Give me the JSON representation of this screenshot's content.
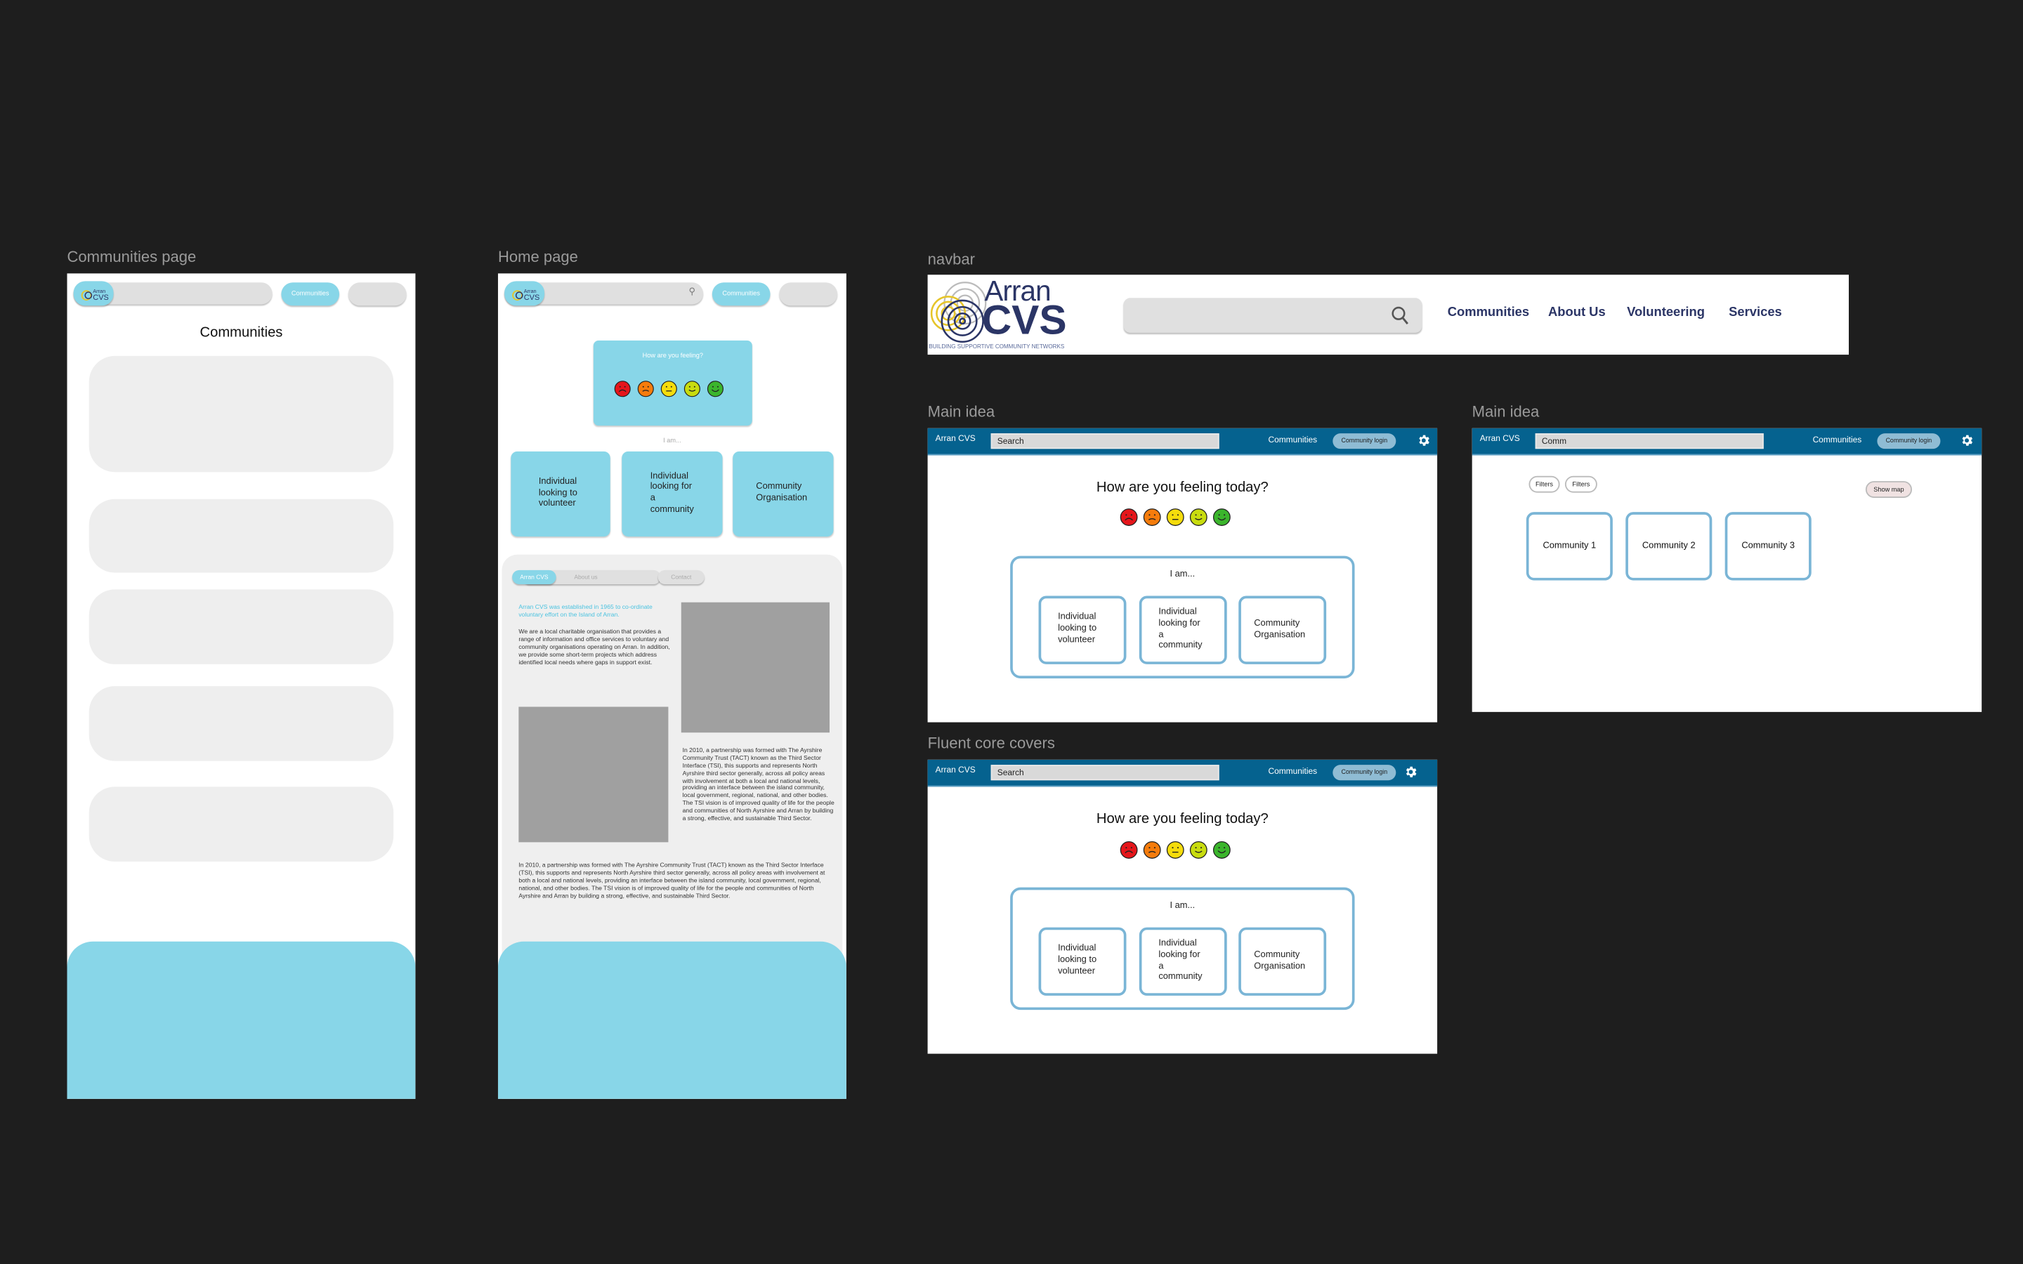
{
  "labels": {
    "communities_page": "Communities page",
    "home_page": "Home page",
    "navbar": "navbar",
    "main_idea_1": "Main idea",
    "main_idea_2": "Main idea",
    "fluent": "Fluent core covers"
  },
  "logo": {
    "line1": "Arran",
    "line2": "CVS",
    "tagline": "BUILDING SUPPORTIVE COMMUNITY NETWORKS"
  },
  "mobile": {
    "communities_btn": "Communities",
    "communities_title": "Communities"
  },
  "home": {
    "feeling": "How are you feeling?",
    "i_am": "I am...",
    "options": [
      "Individual looking to volunteer",
      "Individual looking for a community",
      "Community Organisation"
    ],
    "tabs": [
      "Arran CVS",
      "About us",
      "Contact"
    ],
    "intro": "Arran CVS was established in 1965 to co-ordinate voluntary effort on the Island of Arran.",
    "para1": "We are a local charitable organisation that provides a range of information and office services to voluntary and community organisations operating on Arran. In addition, we provide some short-term projects which address identified local needs where gaps in support exist.",
    "para2": "In 2010, a partnership was formed with The Ayrshire Community Trust (TACT) known as the Third Sector Interface (TSI), this supports and represents North Ayrshire third sector generally, across all policy areas with involvement at both a local and national levels, providing an interface between the island community, local government, regional, national, and other bodies. The TSI vision is of improved quality of life for the people and communities of North Ayrshire and Arran by building a strong, effective, and sustainable Third Sector.",
    "para3": "In 2010, a partnership was formed with The Ayrshire Community Trust (TACT) known as the Third Sector Interface (TSI), this supports and represents North Ayrshire third sector generally, across all policy areas with involvement at both a local and national levels, providing an interface between the island community, local government, regional, national, and other bodies. The TSI vision is of improved quality of life for the people and communities of North Ayrshire and Arran by building a strong, effective, and sustainable Third Sector."
  },
  "navbar": {
    "links": [
      "Communities",
      "About Us",
      "Volunteering",
      "Services"
    ]
  },
  "desktop": {
    "brand": "Arran CVS",
    "search_value": "Search",
    "communities": "Communities",
    "login": "Community login",
    "feeling": "How are you feeling today?",
    "i_am": "I am...",
    "options": [
      "Individual looking to volunteer",
      "Individual looking for a community",
      "Community Organisation"
    ]
  },
  "desktop2": {
    "search_value": "Comm",
    "filters": [
      "Filters",
      "Filters"
    ],
    "show_map": "Show map",
    "cards": [
      "Community 1",
      "Community 2",
      "Community 3"
    ]
  },
  "faces": [
    {
      "mood": "very-sad",
      "color": "#e5161b"
    },
    {
      "mood": "sad",
      "color": "#f57c0c"
    },
    {
      "mood": "neutral",
      "color": "#f5dc0c"
    },
    {
      "mood": "happy",
      "color": "#c8dc0f"
    },
    {
      "mood": "very-happy",
      "color": "#3bb52c"
    }
  ]
}
